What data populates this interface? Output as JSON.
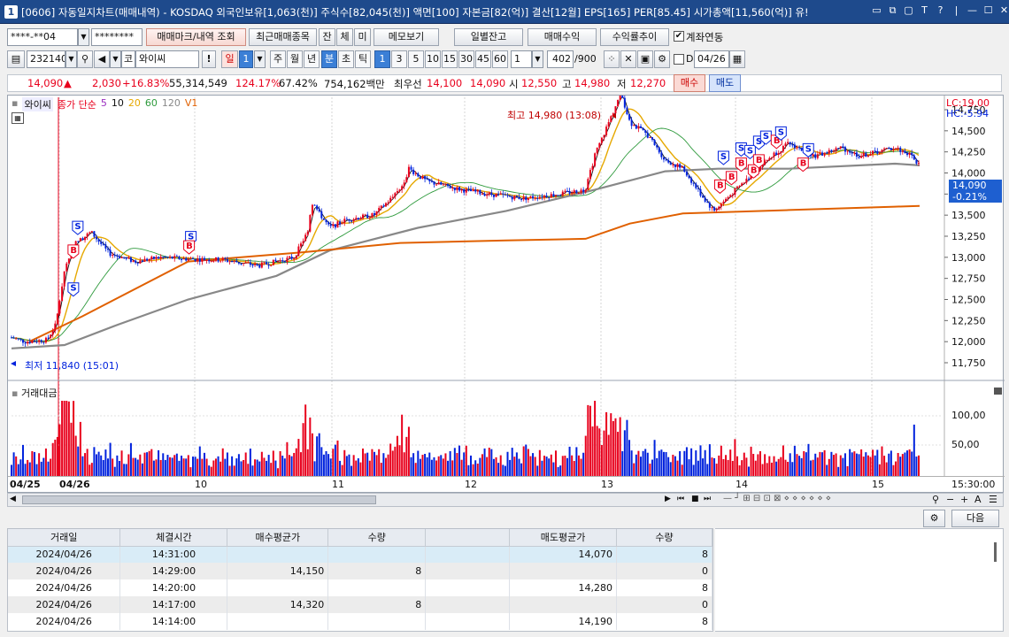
{
  "window": {
    "title": "[0606] 자동일지차트(매매내역) - KOSDAQ 외국인보유[1,063(천)] 주식수[82,045(천)] 액면[100] 자본금[82(억)] 결산[12월] EPS[165] PER[85.45] 시가총액[11,560(억)] 유!",
    "app_badge": "1",
    "title_icons": [
      "window-icon",
      "restore-icon",
      "help-T-icon",
      "T-icon",
      "question-icon",
      "minimize-icon",
      "maximize-icon",
      "close-icon"
    ]
  },
  "row1": {
    "account": "****-**04",
    "password": "********",
    "btn_trade_query": "매매마크/내역 조회",
    "btn_recent": "최근매매종목",
    "btn_jan": "잔",
    "btn_che": "체",
    "btn_mi": "미",
    "btn_memo": "메모보기",
    "btn_daily": "일별잔고",
    "btn_profit": "매매수익",
    "btn_trend": "수익률추이",
    "link_label": "계좌연동",
    "link_checked": "✔"
  },
  "row2": {
    "code": "232140",
    "stock_prefix": "코",
    "stock_name": "와이씨",
    "excl": "!",
    "period_day": "일",
    "period_num": "1",
    "tabs": [
      "주",
      "월",
      "년",
      "분",
      "초",
      "틱"
    ],
    "minute_options": [
      "1",
      "3",
      "5",
      "10",
      "15",
      "30",
      "45",
      "60"
    ],
    "count_value": "1",
    "bars_shown": "402",
    "bars_total": "/900",
    "d_label": "D",
    "date": "04/26"
  },
  "ticker": {
    "price": "14,090",
    "arrow": "▲",
    "change": "2,030",
    "pct": "+16.83%",
    "volume": "55,314,549",
    "vol_ratio": "124.17%",
    "turnover": "67.42%",
    "amount": "754,162백만",
    "best_label": "최우선",
    "ask": "14,100",
    "bid": "14,090",
    "open_label": "시",
    "open": "12,550",
    "high_label": "고",
    "high": "14,980",
    "low_label": "저",
    "low": "12,270",
    "buy": "매수",
    "sell": "매도"
  },
  "chart": {
    "stock_tag": "와이씨",
    "legend": [
      "종가 단순",
      "5",
      "10",
      "20",
      "60",
      "120",
      "V1"
    ],
    "lc": "LC:19.00",
    "hc": "HC:-5.94",
    "high_annotation": "최고 14,980 (13:08)",
    "low_annotation": "최저 11,840 (15:01)",
    "current_price": "14,090",
    "current_pct": "-0.21%",
    "volume_label": "거래대금",
    "volume_ticks": [
      "100,00",
      "50,00"
    ],
    "x_labels": [
      "04/25",
      "04/26",
      "10",
      "11",
      "12",
      "13",
      "14",
      "15",
      "15:30:00"
    ],
    "marker_buy": "B",
    "marker_sell": "S"
  },
  "chart_data": {
    "type": "candlestick",
    "y_ticks": [
      14750,
      14500,
      14250,
      14000,
      13750,
      13500,
      13250,
      13000,
      12750,
      12500,
      12250,
      12000,
      11750
    ],
    "ylim": [
      11650,
      14980
    ],
    "x_labels": [
      "04/25",
      "04/26",
      "10",
      "11",
      "12",
      "13",
      "14",
      "15",
      "15:30:00"
    ],
    "price_path_approx": [
      [
        0,
        12050
      ],
      [
        15,
        12000
      ],
      [
        40,
        12020
      ],
      [
        50,
        12200
      ],
      [
        60,
        12850
      ],
      [
        70,
        13150
      ],
      [
        90,
        13300
      ],
      [
        110,
        13050
      ],
      [
        140,
        12950
      ],
      [
        170,
        13000
      ],
      [
        200,
        12980
      ],
      [
        240,
        12970
      ],
      [
        280,
        12900
      ],
      [
        320,
        13000
      ],
      [
        335,
        13300
      ],
      [
        340,
        13650
      ],
      [
        360,
        13350
      ],
      [
        380,
        13450
      ],
      [
        410,
        13500
      ],
      [
        440,
        13800
      ],
      [
        450,
        14050
      ],
      [
        470,
        13900
      ],
      [
        510,
        13800
      ],
      [
        540,
        13750
      ],
      [
        580,
        13700
      ],
      [
        620,
        13750
      ],
      [
        650,
        13800
      ],
      [
        660,
        14200
      ],
      [
        680,
        14700
      ],
      [
        690,
        14950
      ],
      [
        700,
        14600
      ],
      [
        720,
        14450
      ],
      [
        740,
        14150
      ],
      [
        760,
        14050
      ],
      [
        780,
        13750
      ],
      [
        795,
        13550
      ],
      [
        810,
        13700
      ],
      [
        830,
        13900
      ],
      [
        860,
        14200
      ],
      [
        880,
        14350
      ],
      [
        910,
        14200
      ],
      [
        940,
        14300
      ],
      [
        960,
        14200
      ],
      [
        1000,
        14300
      ],
      [
        1020,
        14200
      ],
      [
        1028,
        14090
      ]
    ],
    "ma120_path_approx": [
      [
        0,
        11920
      ],
      [
        60,
        11960
      ],
      [
        120,
        12200
      ],
      [
        200,
        12500
      ],
      [
        300,
        12780
      ],
      [
        360,
        13080
      ],
      [
        460,
        13350
      ],
      [
        560,
        13550
      ],
      [
        660,
        13800
      ],
      [
        740,
        14020
      ],
      [
        800,
        14050
      ],
      [
        880,
        14050
      ],
      [
        1000,
        14110
      ],
      [
        1028,
        14090
      ]
    ],
    "vwap_path_approx": [
      [
        20,
        12000
      ],
      [
        80,
        12300
      ],
      [
        200,
        12950
      ],
      [
        330,
        13060
      ],
      [
        440,
        13170
      ],
      [
        560,
        13200
      ],
      [
        650,
        13220
      ],
      [
        700,
        13400
      ],
      [
        760,
        13520
      ],
      [
        880,
        13560
      ],
      [
        1000,
        13600
      ],
      [
        1028,
        13610
      ]
    ],
    "volume_ticks": [
      100,
      50
    ]
  },
  "bottom": {
    "next_label": "다음",
    "columns": [
      "거래일",
      "체결시간",
      "매수평균가",
      "수량",
      "",
      "매도평균가",
      "수량"
    ],
    "rows": [
      {
        "date": "2024/04/26",
        "time": "14:31:00",
        "buy_avg": "",
        "buy_qty": "",
        "blank": "",
        "sell_avg": "14,070",
        "sell_qty": "8"
      },
      {
        "date": "2024/04/26",
        "time": "14:29:00",
        "buy_avg": "14,150",
        "buy_qty": "8",
        "blank": "",
        "sell_avg": "",
        "sell_qty": "0"
      },
      {
        "date": "2024/04/26",
        "time": "14:20:00",
        "buy_avg": "",
        "buy_qty": "",
        "blank": "",
        "sell_avg": "14,280",
        "sell_qty": "8"
      },
      {
        "date": "2024/04/26",
        "time": "14:17:00",
        "buy_avg": "14,320",
        "buy_qty": "8",
        "blank": "",
        "sell_avg": "",
        "sell_qty": "0"
      },
      {
        "date": "2024/04/26",
        "time": "14:14:00",
        "buy_avg": "",
        "buy_qty": "",
        "blank": "",
        "sell_avg": "14,190",
        "sell_qty": "8"
      }
    ]
  },
  "colors": {
    "up": "#e8001c",
    "down": "#0022dd",
    "ma5": "#111111",
    "ma20": "#e6a800",
    "ma60": "#2e9a3c",
    "ma120": "#888888",
    "vwap": "#e06000"
  }
}
